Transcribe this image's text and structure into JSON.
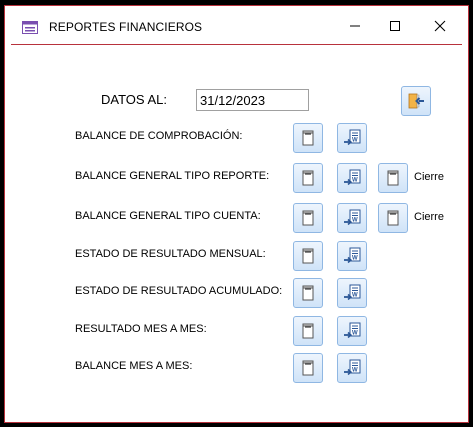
{
  "window": {
    "title": "REPORTES FINANCIEROS",
    "icon": "form-icon",
    "border_color": "#b8323c"
  },
  "datos": {
    "label": "DATOS AL:",
    "date_value": "31/12/2023"
  },
  "exit_button": {
    "icon": "exit-door-icon"
  },
  "rows": [
    {
      "label": "BALANCE DE COMPROBACIÓN:",
      "buttons": [
        "report-preview-icon",
        "export-word-icon"
      ],
      "cierre": null
    },
    {
      "label": "BALANCE GENERAL TIPO REPORTE:",
      "buttons": [
        "report-preview-icon",
        "export-word-icon",
        "report-preview-icon"
      ],
      "cierre": "Cierre"
    },
    {
      "label": "BALANCE GENERAL TIPO CUENTA:",
      "buttons": [
        "report-preview-icon",
        "export-word-icon",
        "report-preview-icon"
      ],
      "cierre": "Cierre"
    },
    {
      "label": "ESTADO  DE RESULTADO MENSUAL:",
      "buttons": [
        "report-preview-icon",
        "export-word-icon"
      ],
      "cierre": null
    },
    {
      "label": "ESTADO  DE RESULTADO ACUMULADO:",
      "buttons": [
        "report-preview-icon",
        "export-word-icon"
      ],
      "cierre": null
    },
    {
      "label": "RESULTADO MES A MES:",
      "buttons": [
        "report-preview-icon",
        "export-word-icon"
      ],
      "cierre": null
    },
    {
      "label": "BALANCE MES A MES:",
      "buttons": [
        "report-preview-icon",
        "export-word-icon"
      ],
      "cierre": null
    }
  ],
  "colors": {
    "button_border": "#8fb7e3",
    "button_fill": "#d9e9fa",
    "accent_orange": "#e8932a",
    "word_blue": "#2b5797"
  }
}
